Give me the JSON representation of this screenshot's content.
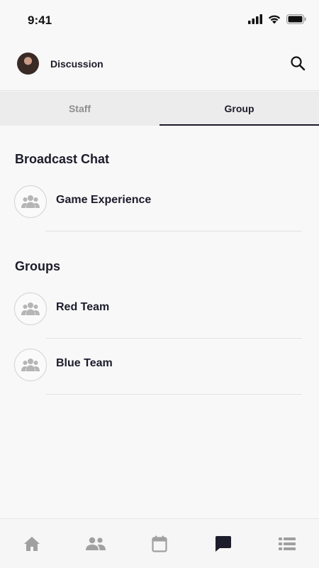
{
  "status_bar": {
    "time": "9:41"
  },
  "header": {
    "title": "Discussion"
  },
  "tabs": [
    {
      "label": "Staff",
      "active": false
    },
    {
      "label": "Group",
      "active": true
    }
  ],
  "broadcast": {
    "title": "Broadcast Chat",
    "items": [
      {
        "label": "Game Experience",
        "icon": "group-icon"
      }
    ]
  },
  "groups": {
    "title": "Groups",
    "items": [
      {
        "label": "Red Team",
        "icon": "group-icon"
      },
      {
        "label": "Blue Team",
        "icon": "group-icon"
      }
    ]
  },
  "bottom_nav": [
    {
      "icon": "home-icon",
      "active": false
    },
    {
      "icon": "people-icon",
      "active": false
    },
    {
      "icon": "calendar-icon",
      "active": false
    },
    {
      "icon": "chat-icon",
      "active": true
    },
    {
      "icon": "list-icon",
      "active": false
    }
  ],
  "colors": {
    "active": "#1c1c2b",
    "inactive": "#a0a0a0",
    "background": "#f8f8f8"
  }
}
